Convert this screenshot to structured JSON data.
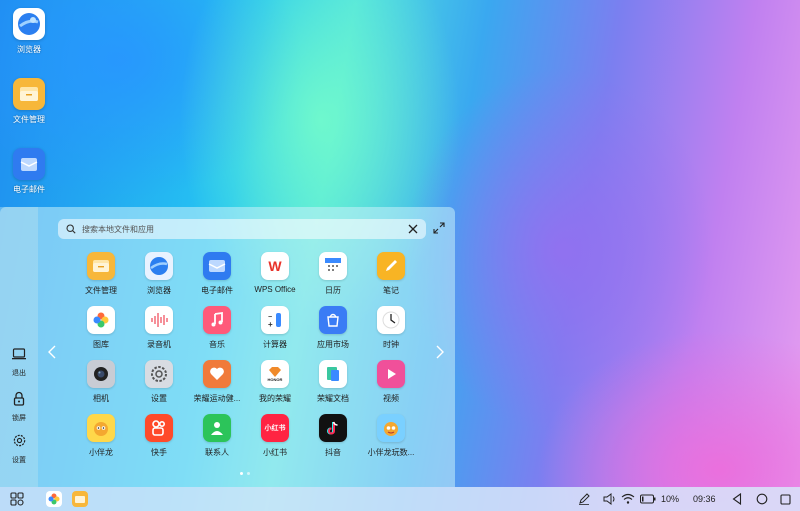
{
  "desktop": {
    "icons": [
      {
        "label": "浏览器",
        "icon": "browser-icon"
      },
      {
        "label": "文件管理",
        "icon": "folder-icon"
      },
      {
        "label": "电子邮件",
        "icon": "mail-icon"
      }
    ]
  },
  "launcher": {
    "search_placeholder": "搜索本地文件和应用",
    "side": {
      "logout_label": "退出",
      "lock_label": "锁屏",
      "settings_label": "设置"
    },
    "apps": [
      {
        "label": "文件管理",
        "icon": "folder-icon",
        "color": "#f7b73a"
      },
      {
        "label": "浏览器",
        "icon": "browser-icon",
        "color": "#e8f2ff"
      },
      {
        "label": "电子邮件",
        "icon": "mail-icon",
        "color": "#2f7bf0"
      },
      {
        "label": "WPS Office",
        "icon": "wps-icon",
        "color": "#ffffff"
      },
      {
        "label": "日历",
        "icon": "calendar-icon",
        "color": "#ffffff"
      },
      {
        "label": "笔记",
        "icon": "notes-icon",
        "color": "#f8b424"
      },
      {
        "label": "图库",
        "icon": "gallery-icon",
        "color": "#ffffff"
      },
      {
        "label": "录音机",
        "icon": "recorder-icon",
        "color": "#ffffff"
      },
      {
        "label": "音乐",
        "icon": "music-icon",
        "color": "#ff5a7a"
      },
      {
        "label": "计算器",
        "icon": "calculator-icon",
        "color": "#ffffff"
      },
      {
        "label": "应用市场",
        "icon": "appstore-icon",
        "color": "#3a7cf5"
      },
      {
        "label": "时钟",
        "icon": "clock-icon",
        "color": "#ffffff"
      },
      {
        "label": "相机",
        "icon": "camera-icon",
        "color": "#c8ccd4"
      },
      {
        "label": "设置",
        "icon": "settings-icon",
        "color": "#d8dce2"
      },
      {
        "label": "荣耀运动健...",
        "icon": "health-icon",
        "color": "#f07a3a"
      },
      {
        "label": "我的荣耀",
        "icon": "honor-icon",
        "color": "#ffffff"
      },
      {
        "label": "荣耀文档",
        "icon": "docs-icon",
        "color": "#ffffff"
      },
      {
        "label": "视频",
        "icon": "video-icon",
        "color": "#f0509a"
      },
      {
        "label": "小伴龙",
        "icon": "dragon-icon",
        "color": "#ffd84a"
      },
      {
        "label": "快手",
        "icon": "kuaishou-icon",
        "color": "#ff4a2a"
      },
      {
        "label": "联系人",
        "icon": "contacts-icon",
        "color": "#2cc45a"
      },
      {
        "label": "小红书",
        "icon": "xiaohongshu-icon",
        "color": "#ff2442"
      },
      {
        "label": "抖音",
        "icon": "douyin-icon",
        "color": "#111111"
      },
      {
        "label": "小伴龙玩数...",
        "icon": "dragon-math-icon",
        "color": "#7ad0ff"
      }
    ],
    "app_glyphs": {
      "wps": "W",
      "xhs": "小红书",
      "honor": "HONOR"
    }
  },
  "taskbar": {
    "battery": "10%",
    "time": "09:36"
  }
}
